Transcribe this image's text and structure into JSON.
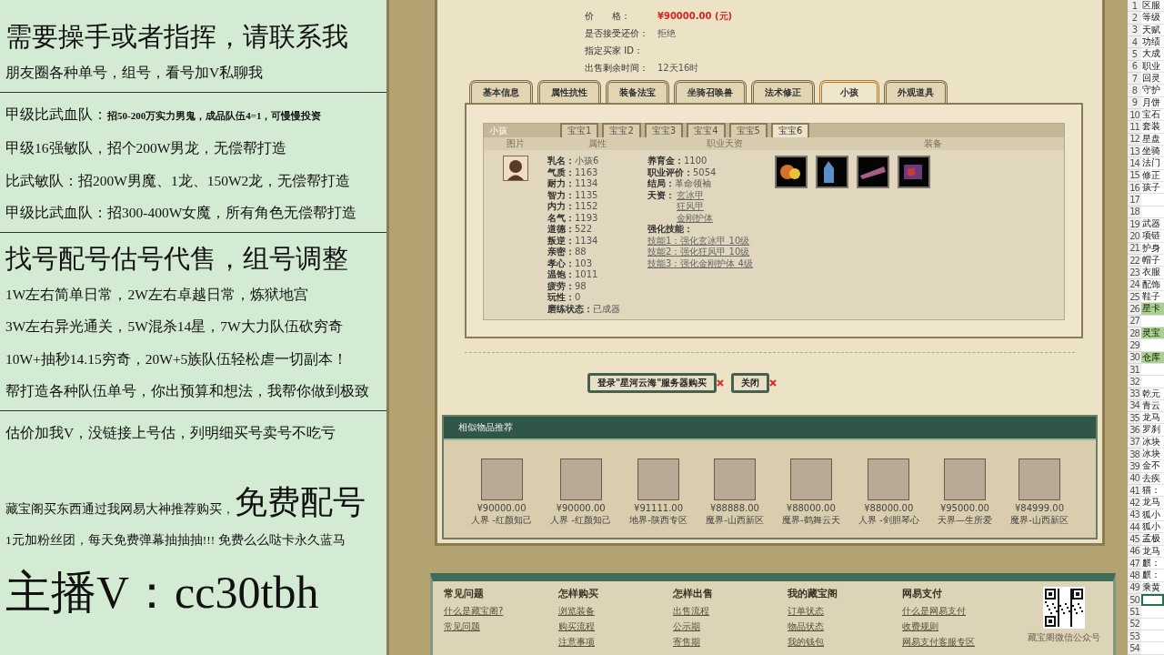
{
  "promo": {
    "groups": [
      [
        {
          "kind": "headline",
          "text": "需要操手或者指挥，请联系我"
        },
        {
          "kind": "text",
          "text": "朋友圈各种单号，组号，看号加V私聊我"
        }
      ],
      [
        {
          "kind": "text",
          "text": "甲级比武血队：**招50-200万实力男鬼，成品队伍4=1，可慢慢投资**"
        },
        {
          "kind": "text",
          "text": "甲级16强敏队，招个200W男龙，无偿帮打造"
        },
        {
          "kind": "text",
          "text": "比武敏队：招200W男魔、1龙、150W2龙，无偿帮打造"
        },
        {
          "kind": "text",
          "text": "甲级比武血队：招300-400W女魔，所有角色无偿帮打造"
        }
      ],
      [
        {
          "kind": "headline",
          "text": "找号配号估号代售，组号调整"
        },
        {
          "kind": "text",
          "text": "1W左右简单日常，2W左右卓越日常，炼狱地宫"
        },
        {
          "kind": "text",
          "text": "3W左右异光通关，5W混杀14星，7W大力队伍砍穷奇"
        },
        {
          "kind": "text",
          "text": "10W+抽秒14.15穷奇，20W+5族队伍轻松虐一切副本！"
        },
        {
          "kind": "text",
          "text": "帮打造各种队伍单号，你出预算和想法，我帮你做到极致"
        }
      ],
      [
        {
          "kind": "text",
          "text": "估价加我V，没链接上号估，列明细买号卖号不吃亏"
        },
        {
          "kind": "mixed",
          "text": "藏宝阁买东西通过我网易大神推荐购买，",
          "emphasis": "免费配号"
        },
        {
          "kind": "small",
          "text": "1元加粉丝团，每天免费弹幕抽抽抽!!! 免费么么哒卡永久蓝马"
        },
        {
          "kind": "banner",
          "text": "主播V：cc30tbh"
        }
      ]
    ]
  },
  "listing": {
    "fields": [
      {
        "label": "价　　格：",
        "value": "¥90000.00 (元)",
        "kind": "price"
      },
      {
        "label": "是否接受还价：",
        "value": "拒绝",
        "kind": "plain"
      },
      {
        "label": "指定买家 ID："
      },
      {
        "label": "出售剩余时间：",
        "value": "12天16时",
        "kind": "plain"
      }
    ],
    "tabs": [
      {
        "label": "基本信息",
        "selected": false
      },
      {
        "label": "属性抗性",
        "selected": false
      },
      {
        "label": "装备法宝",
        "selected": false
      },
      {
        "label": "坐骑召唤兽",
        "selected": false
      },
      {
        "label": "法术修正",
        "selected": false
      },
      {
        "label": "小孩",
        "selected": true
      },
      {
        "label": "外观道具",
        "selected": false
      }
    ]
  },
  "child_panel": {
    "title": "小孩",
    "subtabs": [
      {
        "label": "宝宝1",
        "selected": false
      },
      {
        "label": "宝宝2",
        "selected": false
      },
      {
        "label": "宝宝3",
        "selected": false
      },
      {
        "label": "宝宝4",
        "selected": false
      },
      {
        "label": "宝宝5",
        "selected": false
      },
      {
        "label": "宝宝6",
        "selected": true
      }
    ],
    "columns": [
      "图片",
      "属性",
      "职业天资",
      "装备"
    ],
    "attributes": [
      {
        "label": "乳名：",
        "value": "小孩6"
      },
      {
        "label": "气质：",
        "value": "1163"
      },
      {
        "label": "耐力：",
        "value": "1134"
      },
      {
        "label": "智力：",
        "value": "1135"
      },
      {
        "label": "内力：",
        "value": "1152"
      },
      {
        "label": "名气：",
        "value": "1193"
      },
      {
        "label": "道德：",
        "value": "522"
      },
      {
        "label": "叛逆：",
        "value": "1134"
      },
      {
        "label": "亲密：",
        "value": "88"
      },
      {
        "label": "孝心：",
        "value": "103"
      },
      {
        "label": "温饱：",
        "value": "1011"
      },
      {
        "label": "疲劳：",
        "value": "98"
      },
      {
        "label": "玩性：",
        "value": "0"
      },
      {
        "label": "磨练状态：",
        "value": "已成器"
      }
    ],
    "details": [
      {
        "label": "养育金：",
        "value": "1100"
      },
      {
        "label": "职业评价：",
        "value": "5054"
      },
      {
        "label": "结局：",
        "value": "革命领袖"
      }
    ],
    "talents_label": "天资：",
    "talents": [
      "玄冰甲",
      "狂风甲",
      "金刚护体"
    ],
    "skills_label": "强化技能：",
    "skills": [
      "技能1：强化玄冰甲 10级",
      "技能2：强化狂风甲 10级",
      "技能3：强化金刚护体 4级"
    ]
  },
  "buttons": [
    {
      "label": "登录\"星河云海\"服务器购买"
    },
    {
      "label": "关闭"
    }
  ],
  "recommendations": {
    "title": "相似物品推荐",
    "items": [
      {
        "price": "¥90000.00",
        "server": "人界 -红颜知己"
      },
      {
        "price": "¥90000.00",
        "server": "人界 -红颜知己"
      },
      {
        "price": "¥91111.00",
        "server": "地界-陕西专区"
      },
      {
        "price": "¥88888.00",
        "server": "魔界-山西新区"
      },
      {
        "price": "¥88000.00",
        "server": "魔界-鹤舞云天"
      },
      {
        "price": "¥88000.00",
        "server": "人界 -剑胆琴心"
      },
      {
        "price": "¥95000.00",
        "server": "天界—生所爱"
      },
      {
        "price": "¥84999.00",
        "server": "魔界-山西新区"
      }
    ]
  },
  "footer": {
    "columns": [
      {
        "title": "常见问题",
        "links": [
          "什么是藏宝阁?",
          "常见问题"
        ]
      },
      {
        "title": "怎样购买",
        "links": [
          "浏览装备",
          "购买流程",
          "注意事项"
        ]
      },
      {
        "title": "怎样出售",
        "links": [
          "出售流程",
          "公示期",
          "寄售期"
        ]
      },
      {
        "title": "我的藏宝阁",
        "links": [
          "订单状态",
          "物品状态",
          "我的钱包"
        ]
      },
      {
        "title": "网易支付",
        "links": [
          "什么是网易支付",
          "收费规则",
          "网易支付客服专区"
        ]
      }
    ],
    "qr_caption": "藏宝阁微信公众号"
  },
  "sheet": {
    "rows": [
      {
        "number": "1",
        "cell": "区服",
        "highlighted": false,
        "selected": false
      },
      {
        "number": "2",
        "cell": "等级",
        "highlighted": false,
        "selected": false
      },
      {
        "number": "3",
        "cell": "天赋",
        "highlighted": false,
        "selected": false
      },
      {
        "number": "4",
        "cell": "功绩",
        "highlighted": false,
        "selected": false
      },
      {
        "number": "5",
        "cell": "大成",
        "highlighted": false,
        "selected": false
      },
      {
        "number": "6",
        "cell": "职业",
        "highlighted": false,
        "selected": false
      },
      {
        "number": "7",
        "cell": "回灵",
        "highlighted": false,
        "selected": false
      },
      {
        "number": "8",
        "cell": "守护",
        "highlighted": false,
        "selected": false
      },
      {
        "number": "9",
        "cell": "月饼",
        "highlighted": false,
        "selected": false
      },
      {
        "number": "10",
        "cell": "宝石",
        "highlighted": false,
        "selected": false
      },
      {
        "number": "11",
        "cell": "套装",
        "highlighted": false,
        "selected": false
      },
      {
        "number": "12",
        "cell": "星盘",
        "highlighted": false,
        "selected": false
      },
      {
        "number": "13",
        "cell": "坐骑",
        "highlighted": false,
        "selected": false
      },
      {
        "number": "14",
        "cell": "法门",
        "highlighted": false,
        "selected": false
      },
      {
        "number": "15",
        "cell": "修正",
        "highlighted": false,
        "selected": false
      },
      {
        "number": "16",
        "cell": "孩子",
        "highlighted": false,
        "selected": false
      },
      {
        "number": "17",
        "highlighted": false,
        "selected": false
      },
      {
        "number": "18",
        "highlighted": false,
        "selected": false
      },
      {
        "number": "19",
        "cell": "武器",
        "highlighted": false,
        "selected": false
      },
      {
        "number": "20",
        "cell": "项链",
        "highlighted": false,
        "selected": false
      },
      {
        "number": "21",
        "cell": "护身",
        "highlighted": false,
        "selected": false
      },
      {
        "number": "22",
        "cell": "帽子",
        "highlighted": false,
        "selected": false
      },
      {
        "number": "23",
        "cell": "衣服",
        "highlighted": false,
        "selected": false
      },
      {
        "number": "24",
        "cell": "配饰",
        "highlighted": false,
        "selected": false
      },
      {
        "number": "25",
        "cell": "鞋子",
        "highlighted": false,
        "selected": false
      },
      {
        "number": "26",
        "cell": "星卡",
        "highlighted": true,
        "selected": false
      },
      {
        "number": "27",
        "highlighted": false,
        "selected": false
      },
      {
        "number": "28",
        "cell": "灵宝",
        "highlighted": true,
        "selected": false
      },
      {
        "number": "29",
        "highlighted": false,
        "selected": false
      },
      {
        "number": "30",
        "cell": "仓库",
        "highlighted": true,
        "selected": false
      },
      {
        "number": "31",
        "highlighted": false,
        "selected": false
      },
      {
        "number": "32",
        "highlighted": false,
        "selected": false
      },
      {
        "number": "33",
        "cell": "乾元",
        "highlighted": false,
        "selected": false
      },
      {
        "number": "34",
        "cell": "青云",
        "highlighted": false,
        "selected": false
      },
      {
        "number": "35",
        "cell": "龙马",
        "highlighted": false,
        "selected": false
      },
      {
        "number": "36",
        "cell": "罗刹",
        "highlighted": false,
        "selected": false
      },
      {
        "number": "37",
        "cell": "冰块",
        "highlighted": false,
        "selected": false
      },
      {
        "number": "38",
        "cell": "冰块",
        "highlighted": false,
        "selected": false
      },
      {
        "number": "39",
        "cell": "金不",
        "highlighted": false,
        "selected": false
      },
      {
        "number": "40",
        "cell": "去疾",
        "highlighted": false,
        "selected": false
      },
      {
        "number": "41",
        "cell": "猫：",
        "highlighted": false,
        "selected": false
      },
      {
        "number": "42",
        "cell": "龙马",
        "highlighted": false,
        "selected": false
      },
      {
        "number": "43",
        "cell": "狐小",
        "highlighted": false,
        "selected": false
      },
      {
        "number": "44",
        "cell": "狐小",
        "highlighted": false,
        "selected": false
      },
      {
        "number": "45",
        "cell": "孟极",
        "highlighted": false,
        "selected": false
      },
      {
        "number": "46",
        "cell": "龙马",
        "highlighted": false,
        "selected": false
      },
      {
        "number": "47",
        "cell": "麒：",
        "highlighted": false,
        "selected": false
      },
      {
        "number": "48",
        "cell": "麒：",
        "highlighted": false,
        "selected": false
      },
      {
        "number": "49",
        "cell": "乘黄",
        "highlighted": false,
        "selected": false
      },
      {
        "number": "50",
        "highlighted": false,
        "selected": true
      },
      {
        "number": "51",
        "highlighted": false,
        "selected": false
      },
      {
        "number": "52",
        "highlighted": false,
        "selected": false
      },
      {
        "number": "53",
        "highlighted": false,
        "selected": false
      },
      {
        "number": "54",
        "highlighted": false,
        "selected": false
      }
    ]
  }
}
